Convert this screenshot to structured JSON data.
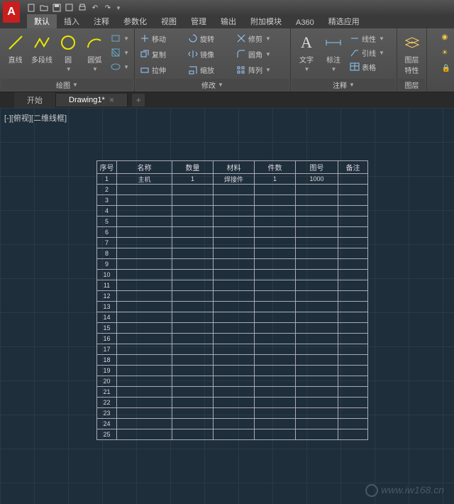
{
  "qat": [
    "new",
    "open",
    "save",
    "print",
    "undo",
    "redo"
  ],
  "ribbonTabs": [
    "默认",
    "插入",
    "注释",
    "参数化",
    "视图",
    "管理",
    "输出",
    "附加模块",
    "A360",
    "精选应用"
  ],
  "activeRibbonTab": 0,
  "panels": {
    "draw": {
      "title": "绘图",
      "items": [
        "直线",
        "多段线",
        "圆",
        "圆弧"
      ]
    },
    "modify": {
      "title": "修改",
      "items": [
        {
          "label": "移动",
          "ico": "move"
        },
        {
          "label": "旋转",
          "ico": "rotate"
        },
        {
          "label": "修剪",
          "ico": "trim"
        },
        {
          "label": "复制",
          "ico": "copy"
        },
        {
          "label": "镜像",
          "ico": "mirror"
        },
        {
          "label": "圆角",
          "ico": "fillet"
        },
        {
          "label": "拉伸",
          "ico": "stretch"
        },
        {
          "label": "缩放",
          "ico": "scale"
        },
        {
          "label": "阵列",
          "ico": "array"
        }
      ]
    },
    "annot": {
      "title": "注释",
      "items": [
        "文字",
        "标注",
        "引线",
        "表格",
        "线性"
      ]
    },
    "layer": {
      "title": "图层",
      "label": "图层\n特性"
    }
  },
  "fileTabs": [
    {
      "label": "开始",
      "active": false
    },
    {
      "label": "Drawing1*",
      "active": true
    }
  ],
  "viewportLabel": "[-][俯视][二维线框]",
  "chart_data": {
    "type": "table",
    "title": "",
    "headers": [
      "序号",
      "名称",
      "数量",
      "材料",
      "件数",
      "图号",
      "备注"
    ],
    "rows": [
      [
        "1",
        "主机",
        "1",
        "焊接件",
        "1",
        "1000",
        ""
      ],
      [
        "2",
        "",
        "",
        "",
        "",
        "",
        ""
      ],
      [
        "3",
        "",
        "",
        "",
        "",
        "",
        ""
      ],
      [
        "4",
        "",
        "",
        "",
        "",
        "",
        ""
      ],
      [
        "5",
        "",
        "",
        "",
        "",
        "",
        ""
      ],
      [
        "6",
        "",
        "",
        "",
        "",
        "",
        ""
      ],
      [
        "7",
        "",
        "",
        "",
        "",
        "",
        ""
      ],
      [
        "8",
        "",
        "",
        "",
        "",
        "",
        ""
      ],
      [
        "9",
        "",
        "",
        "",
        "",
        "",
        ""
      ],
      [
        "10",
        "",
        "",
        "",
        "",
        "",
        ""
      ],
      [
        "11",
        "",
        "",
        "",
        "",
        "",
        ""
      ],
      [
        "12",
        "",
        "",
        "",
        "",
        "",
        ""
      ],
      [
        "13",
        "",
        "",
        "",
        "",
        "",
        ""
      ],
      [
        "14",
        "",
        "",
        "",
        "",
        "",
        ""
      ],
      [
        "15",
        "",
        "",
        "",
        "",
        "",
        ""
      ],
      [
        "16",
        "",
        "",
        "",
        "",
        "",
        ""
      ],
      [
        "17",
        "",
        "",
        "",
        "",
        "",
        ""
      ],
      [
        "18",
        "",
        "",
        "",
        "",
        "",
        ""
      ],
      [
        "19",
        "",
        "",
        "",
        "",
        "",
        ""
      ],
      [
        "20",
        "",
        "",
        "",
        "",
        "",
        ""
      ],
      [
        "21",
        "",
        "",
        "",
        "",
        "",
        ""
      ],
      [
        "22",
        "",
        "",
        "",
        "",
        "",
        ""
      ],
      [
        "23",
        "",
        "",
        "",
        "",
        "",
        ""
      ],
      [
        "24",
        "",
        "",
        "",
        "",
        "",
        ""
      ],
      [
        "25",
        "",
        "",
        "",
        "",
        "",
        ""
      ]
    ]
  },
  "watermark": "www.iw168.cn"
}
